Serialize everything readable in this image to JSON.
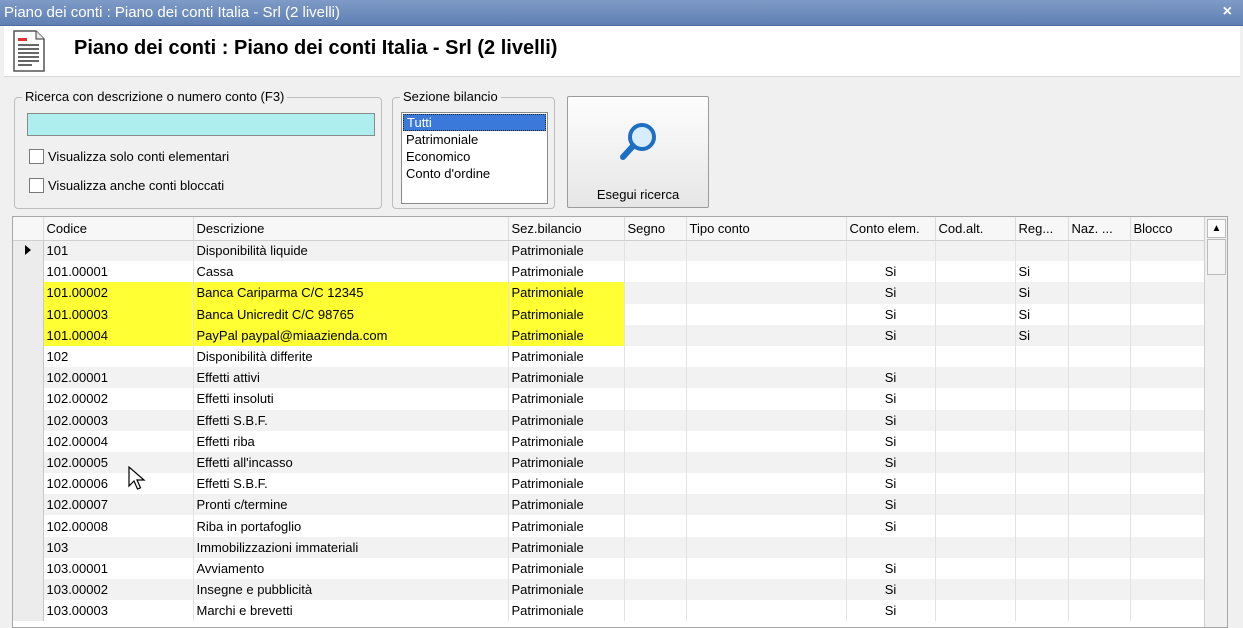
{
  "window": {
    "title": "Piano dei conti : Piano dei conti Italia - Srl (2 livelli)",
    "close_glyph": "×"
  },
  "header": {
    "title": "Piano dei conti : Piano dei conti Italia - Srl (2 livelli)",
    "icon": "document-icon"
  },
  "search": {
    "legend": "Ricerca con descrizione o numero conto (F3)",
    "value": "",
    "checkbox_elementari": "Visualizza solo conti elementari",
    "checkbox_bloccati": "Visualizza anche conti bloccati"
  },
  "sezione": {
    "legend": "Sezione bilancio",
    "options": [
      "Tutti",
      "Patrimoniale",
      "Economico",
      "Conto d'ordine"
    ],
    "selected": "Tutti"
  },
  "search_button": {
    "label": "Esegui ricerca",
    "icon": "magnifier-icon"
  },
  "colors": {
    "highlight": "#ffff33",
    "search_bg": "#aeeeee",
    "selection": "#3a78d9"
  },
  "grid": {
    "columns": [
      "Codice",
      "Descrizione",
      "Sez.bilancio",
      "Segno",
      "Tipo conto",
      "Conto elem.",
      "Cod.alt.",
      "Reg...",
      "Naz. ...",
      "Blocco"
    ],
    "rows": [
      {
        "codice": "101",
        "descrizione": "Disponibilità liquide",
        "sez": "Patrimoniale",
        "elem": "",
        "reg": "",
        "current": true
      },
      {
        "codice": "101.00001",
        "descrizione": "Cassa",
        "sez": "Patrimoniale",
        "elem": "Si",
        "reg": "Si"
      },
      {
        "codice": "101.00002",
        "descrizione": "Banca Cariparma C/C 12345",
        "sez": "Patrimoniale",
        "elem": "Si",
        "reg": "Si",
        "highlight": true
      },
      {
        "codice": "101.00003",
        "descrizione": "Banca Unicredit C/C 98765",
        "sez": "Patrimoniale",
        "elem": "Si",
        "reg": "Si",
        "highlight": true
      },
      {
        "codice": "101.00004",
        "descrizione": "PayPal paypal@miaazienda.com",
        "sez": "Patrimoniale",
        "elem": "Si",
        "reg": "Si",
        "highlight": true
      },
      {
        "codice": "102",
        "descrizione": "Disponibilità differite",
        "sez": "Patrimoniale",
        "elem": "",
        "reg": ""
      },
      {
        "codice": "102.00001",
        "descrizione": "Effetti attivi",
        "sez": "Patrimoniale",
        "elem": "Si",
        "reg": ""
      },
      {
        "codice": "102.00002",
        "descrizione": "Effetti insoluti",
        "sez": "Patrimoniale",
        "elem": "Si",
        "reg": ""
      },
      {
        "codice": "102.00003",
        "descrizione": "Effetti S.B.F.",
        "sez": "Patrimoniale",
        "elem": "Si",
        "reg": ""
      },
      {
        "codice": "102.00004",
        "descrizione": "Effetti riba",
        "sez": "Patrimoniale",
        "elem": "Si",
        "reg": ""
      },
      {
        "codice": "102.00005",
        "descrizione": "Effetti all'incasso",
        "sez": "Patrimoniale",
        "elem": "Si",
        "reg": ""
      },
      {
        "codice": "102.00006",
        "descrizione": "Effetti S.B.F.",
        "sez": "Patrimoniale",
        "elem": "Si",
        "reg": ""
      },
      {
        "codice": "102.00007",
        "descrizione": "Pronti c/termine",
        "sez": "Patrimoniale",
        "elem": "Si",
        "reg": ""
      },
      {
        "codice": "102.00008",
        "descrizione": "Riba in portafoglio",
        "sez": "Patrimoniale",
        "elem": "Si",
        "reg": ""
      },
      {
        "codice": "103",
        "descrizione": "Immobilizzazioni immateriali",
        "sez": "Patrimoniale",
        "elem": "",
        "reg": ""
      },
      {
        "codice": "103.00001",
        "descrizione": "Avviamento",
        "sez": "Patrimoniale",
        "elem": "Si",
        "reg": ""
      },
      {
        "codice": "103.00002",
        "descrizione": "Insegne e pubblicità",
        "sez": "Patrimoniale",
        "elem": "Si",
        "reg": ""
      },
      {
        "codice": "103.00003",
        "descrizione": "Marchi e brevetti",
        "sez": "Patrimoniale",
        "elem": "Si",
        "reg": ""
      }
    ]
  }
}
